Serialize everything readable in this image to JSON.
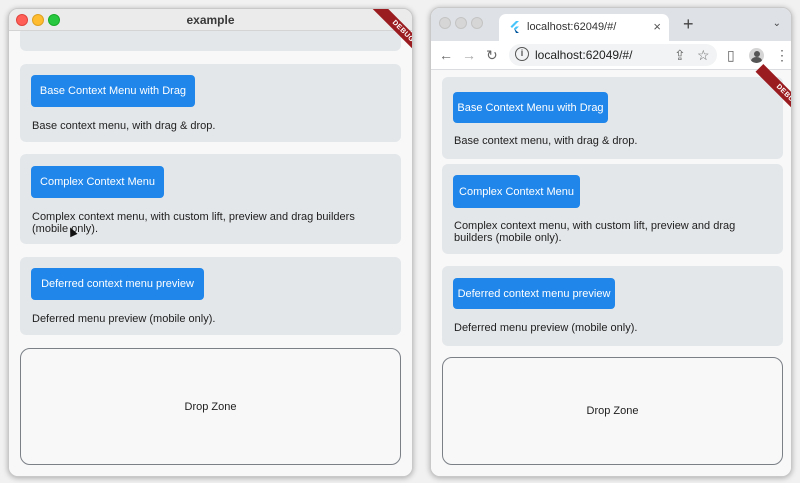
{
  "left_window": {
    "title": "example",
    "debug_label": "DEBUG",
    "cards": [
      {
        "button": "Base Context Menu with Drag",
        "description": "Base context menu, with drag & drop."
      },
      {
        "button": "Complex Context Menu",
        "description": "Complex context menu, with custom lift, preview and drag builders (mobile only)."
      },
      {
        "button": "Deferred context menu preview",
        "description": "Deferred menu preview (mobile only)."
      }
    ],
    "drop_zone": "Drop Zone"
  },
  "right_window": {
    "tab": {
      "title": "localhost:62049/#/",
      "close": "×",
      "favicon": "flutter-icon"
    },
    "new_tab": "+",
    "tab_menu": "⌄",
    "toolbar": {
      "back": "←",
      "forward": "→",
      "reload": "↻",
      "url": "localhost:62049/#/",
      "info": "i",
      "share": "⇪",
      "bookmark": "☆",
      "sidebar": "▯",
      "menu": "⋮"
    },
    "debug_label": "DEBUG",
    "cards": [
      {
        "button": "Base Context Menu with Drag",
        "description": "Base context menu, with drag & drop."
      },
      {
        "button": "Complex Context Menu",
        "description": "Complex context menu, with custom lift, preview and drag builders (mobile only)."
      },
      {
        "button": "Deferred context menu preview",
        "description": "Deferred menu preview (mobile only)."
      }
    ],
    "drop_zone": "Drop Zone"
  },
  "colors": {
    "button_blue": "#2086ea",
    "card_bg": "#e4e7ea",
    "debug_ribbon": "#9b1c20"
  }
}
